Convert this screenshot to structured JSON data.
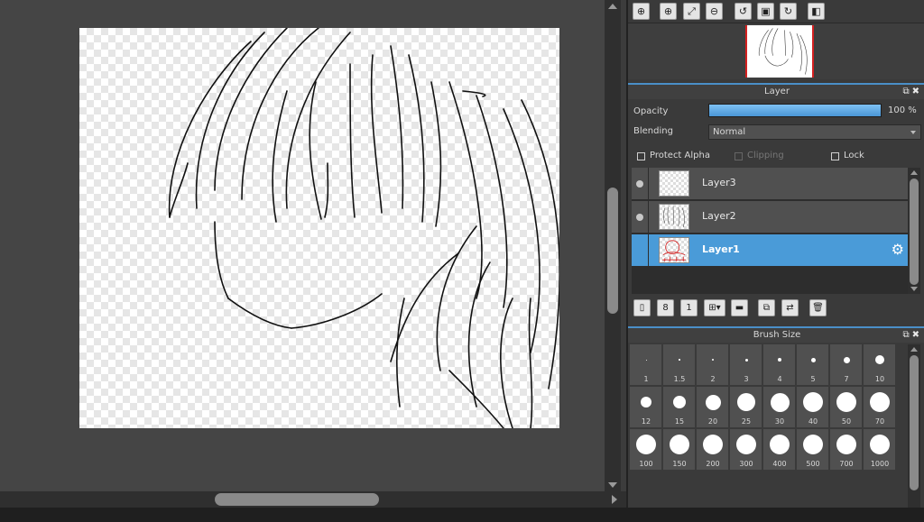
{
  "icons": {
    "nav_toolbar": [
      "zoom-reset-icon",
      "zoom-in-icon",
      "fit-window-icon",
      "zoom-out-icon",
      "rotate-left-icon",
      "fit-canvas-icon",
      "rotate-right-icon",
      "flip-icon"
    ],
    "layer_toolbar": [
      "new-layer-icon",
      "new-8bit-layer-icon",
      "new-1bit-layer-icon",
      "add-layer-menu-icon",
      "new-folder-icon",
      "duplicate-layer-icon",
      "merge-layer-icon",
      "delete-layer-icon"
    ]
  },
  "layer_panel": {
    "title": "Layer",
    "opacity_label": "Opacity",
    "opacity_value": "100 %",
    "opacity_fraction": 1.0,
    "blending_label": "Blending",
    "blending_value": "Normal",
    "protect_alpha": "Protect Alpha",
    "clipping": "Clipping",
    "lock": "Lock",
    "layers": [
      {
        "name": "Layer3",
        "visible": true,
        "selected": false
      },
      {
        "name": "Layer2",
        "visible": true,
        "selected": false
      },
      {
        "name": "Layer1",
        "visible": false,
        "selected": true
      }
    ]
  },
  "brush_panel": {
    "title": "Brush Size",
    "sizes": [
      "1",
      "1.5",
      "2",
      "3",
      "4",
      "5",
      "7",
      "10",
      "12",
      "15",
      "20",
      "25",
      "30",
      "40",
      "50",
      "70",
      "100",
      "150",
      "200",
      "300",
      "400",
      "500",
      "700",
      "1000"
    ]
  },
  "colors": {
    "accent": "#4a9bd8",
    "selection_red": "#d42020"
  }
}
